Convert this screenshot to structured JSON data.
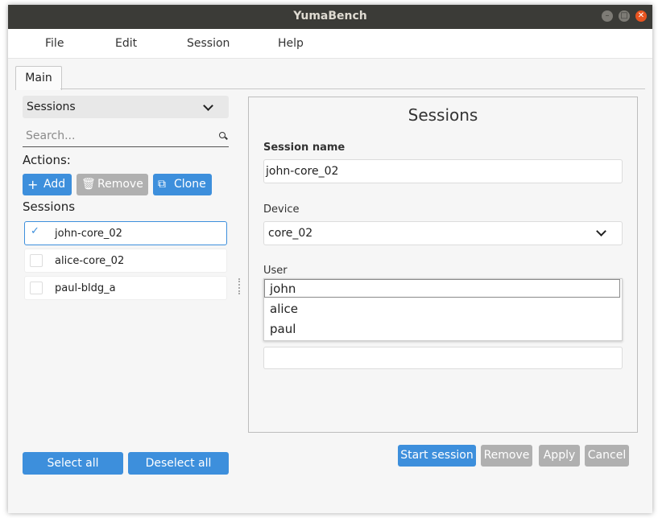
{
  "window": {
    "title": "YumaBench"
  },
  "menu": {
    "file": "File",
    "edit": "Edit",
    "session": "Session",
    "help": "Help"
  },
  "tabs": [
    {
      "label": "Main"
    }
  ],
  "left": {
    "combo_value": "Sessions",
    "search_placeholder": "Search...",
    "actions_label": "Actions:",
    "add_label": "Add",
    "remove_label": "Remove",
    "clone_label": "Clone",
    "sessions_label": "Sessions",
    "items": [
      {
        "label": "john-core_02",
        "checked": true
      },
      {
        "label": "alice-core_02",
        "checked": false
      },
      {
        "label": "paul-bldg_a",
        "checked": false
      }
    ],
    "select_all": "Select all",
    "deselect_all": "Deselect all"
  },
  "form": {
    "title": "Sessions",
    "session_name_label": "Session name",
    "session_name_value": "john-core_02",
    "device_label": "Device",
    "device_value": "core_02",
    "user_label": "User",
    "user_options": [
      "john",
      "alice",
      "paul"
    ]
  },
  "footer": {
    "start_session": "Start session",
    "remove": "Remove",
    "apply": "Apply",
    "cancel": "Cancel"
  },
  "colors": {
    "accent": "#3d8fdc",
    "disabled": "#b0b0b0",
    "titlebar": "#3b3b37",
    "close": "#e95420"
  },
  "icons": {
    "add": "plus-icon",
    "remove": "trash-icon",
    "clone": "copy-icon",
    "search": "search-icon"
  }
}
